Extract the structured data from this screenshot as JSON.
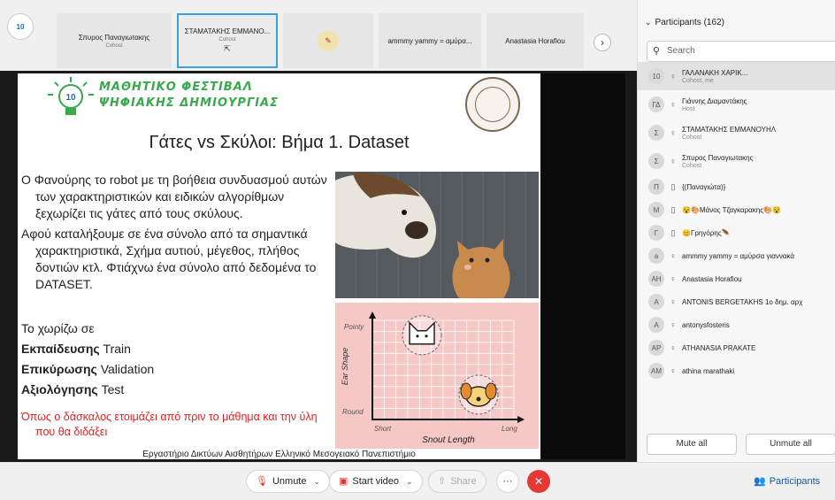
{
  "gallery": {
    "tiles": [
      {
        "name": "Σπυρος Παναγιωτακης",
        "role": "Cohost"
      },
      {
        "name": "ΣΤΑΜΑΤΑΚΗΣ ΕΜΜΑΝΟ...",
        "role": "Cohost",
        "sharing_icon": "⇱"
      },
      {
        "name": "ammmy yammy = αμύρα...",
        "role": ""
      },
      {
        "name": "Anastasia Horafiou",
        "role": ""
      }
    ],
    "self_badge": "10",
    "next_label": "›"
  },
  "slide": {
    "logo_line1": "ΜΑΘΗΤΙΚΟ ΦΕΣΤΙΒΑΛ",
    "logo_line2": "ΨΗΦΙΑΚΗΣ ΔΗΜΙΟΥΡΓΙΑΣ",
    "logo_badge": "10",
    "title": "Γάτες vs Σκύλοι:  Βήμα 1. Dataset",
    "bullet1": "Ο Φανούρης το robot με τη βοήθεια συνδυασμού αυτών των χαρακτηριστικών και ειδικών αλγορίθμων ξεχωρίζει τις γάτες από τους σκύλους.",
    "bullet2": "Αφού καταλήξουμε σε ένα σύνολο από τα σημαντικά χαρακτηριστικά, Σχήμα αυτιού, μέγεθος, πλήθος δοντιών κτλ. Φτιάχνω ένα σύνολο από δεδομένα το DATASET.",
    "split_intro": "Το χωρίζω σε",
    "train_bold": "Εκπαίδευσης",
    "train_label": " Train",
    "valid_bold": "Επικύρωσης",
    "valid_label": " Validation",
    "test_bold": "Αξιολόγησης",
    "test_label": " Test",
    "note": "Όπως ο δάσκαλος ετοιμάζει από πριν  το  μάθημα και την ύλη που θα διδάξει",
    "footer": "Εργαστήριο Δικτύων Αισθητήρων Ελληνικό Μεσογειακό Πανεπιστήμιο"
  },
  "chart_data": {
    "type": "scatter",
    "title": "",
    "xlabel": "Snout Length",
    "ylabel": "Ear Shape",
    "x_ticks": [
      "Short",
      "Long"
    ],
    "y_ticks": [
      "Round",
      "Pointy"
    ],
    "series": [
      {
        "values": [
          [
            0.35,
            0.85
          ]
        ],
        "glyph": "cat"
      },
      {
        "values": [
          [
            0.75,
            0.25
          ]
        ],
        "glyph": "dog"
      }
    ],
    "grid": true
  },
  "panel": {
    "header": "Participants (162)",
    "search_placeholder": "Search",
    "participants": [
      {
        "initials": "10",
        "mic": "♀",
        "name": "ΓΑΛΑΝΑΚΗ ΧΑΡΙΚ...",
        "sub": "Cohost, me",
        "selected": true
      },
      {
        "initials": "ΓΔ",
        "mic": "♀",
        "name": "Γιάννης Διαμαντάκης",
        "sub": "Host"
      },
      {
        "initials": "Σ",
        "mic": "♀",
        "name": "ΣΤΑΜΑΤΑΚΗΣ ΕΜΜΑΝΟΥΗΛ",
        "sub": "Cohost"
      },
      {
        "initials": "Σ",
        "mic": "♀",
        "name": "Σπυρος Παναγιωτακης",
        "sub": "Cohost"
      },
      {
        "initials": "Π",
        "mic": "▯",
        "name": "{(Παναγιώτα)}",
        "sub": ""
      },
      {
        "initials": "Μ",
        "mic": "▯",
        "name": "😵🎨Μάνος Τζαγκαρακης🎨😵",
        "sub": ""
      },
      {
        "initials": "Γ",
        "mic": "▯",
        "name": "😊Γρηγόρης🪶",
        "sub": ""
      },
      {
        "initials": "a",
        "mic": "♀",
        "name": "ammmy yammy = αμύρσα γιαννακά",
        "sub": ""
      },
      {
        "initials": "AH",
        "mic": "♀",
        "name": "Anastasia Horafiou",
        "sub": ""
      },
      {
        "initials": "A",
        "mic": "♀",
        "name": "ANTONIS BERGETAKHS 1ο δημ. αρχ",
        "sub": ""
      },
      {
        "initials": "A",
        "mic": "♀",
        "name": "antonysfosteris",
        "sub": ""
      },
      {
        "initials": "AP",
        "mic": "♀",
        "name": "ATHANASIA PRAKATE",
        "sub": ""
      },
      {
        "initials": "AM",
        "mic": "♀",
        "name": "athina marathaki",
        "sub": ""
      }
    ],
    "mute_all": "Mute all",
    "unmute_all": "Unmute all"
  },
  "toolbar": {
    "unmute": "Unmute",
    "start_video": "Start video",
    "share": "Share",
    "more": "···",
    "end": "✕",
    "participants": "Participants"
  }
}
